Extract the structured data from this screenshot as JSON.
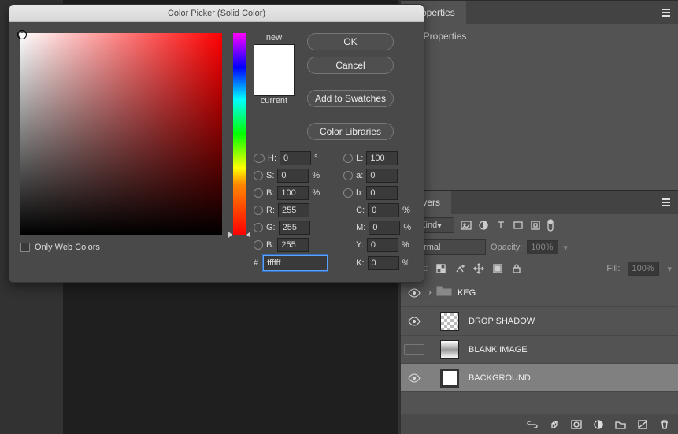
{
  "dialog": {
    "title": "Color Picker (Solid Color)",
    "new_label": "new",
    "current_label": "current",
    "new_color": "#ffffff",
    "current_color": "#ffffff",
    "buttons": {
      "ok": "OK",
      "cancel": "Cancel",
      "addswatch": "Add to Swatches",
      "libs": "Color Libraries"
    },
    "hsb": {
      "H": "0",
      "S": "0",
      "B": "100"
    },
    "lab": {
      "L": "100",
      "a": "0",
      "b": "0"
    },
    "rgb": {
      "R": "255",
      "G": "255",
      "B": "255"
    },
    "cmyk": {
      "C": "0",
      "M": "0",
      "Y": "0",
      "K": "0"
    },
    "labels": {
      "H": "H:",
      "S": "S:",
      "B": "B:",
      "L": "L:",
      "a": "a:",
      "b": "b:",
      "R": "R:",
      "G": "G:",
      "Bb": "B:",
      "C": "C:",
      "M": "M:",
      "Y": "Y:",
      "K": "K:",
      "deg": "°",
      "pct": "%",
      "hash": "#"
    },
    "hex": "ffffff",
    "web_only_label": "Only Web Colors"
  },
  "prop_panel": {
    "tab": "Properties",
    "heading": "No Properties"
  },
  "layers_panel": {
    "tab": "Layers",
    "filter_label": "Kind",
    "opacity_label": "Opacity:",
    "opacity_value": "100%",
    "blend": "Normal",
    "lock_label": "Lock:",
    "fill_label": "Fill:",
    "fill_value": "100%",
    "layers": [
      {
        "name": "KEG",
        "type": "group",
        "visible": true,
        "selected": false
      },
      {
        "name": "DROP SHADOW",
        "type": "checker",
        "visible": true,
        "selected": false
      },
      {
        "name": "BLANK IMAGE",
        "type": "gradient",
        "visible": false,
        "selected": false
      },
      {
        "name": "BACKGROUND",
        "type": "monitor",
        "visible": true,
        "selected": true
      }
    ]
  }
}
